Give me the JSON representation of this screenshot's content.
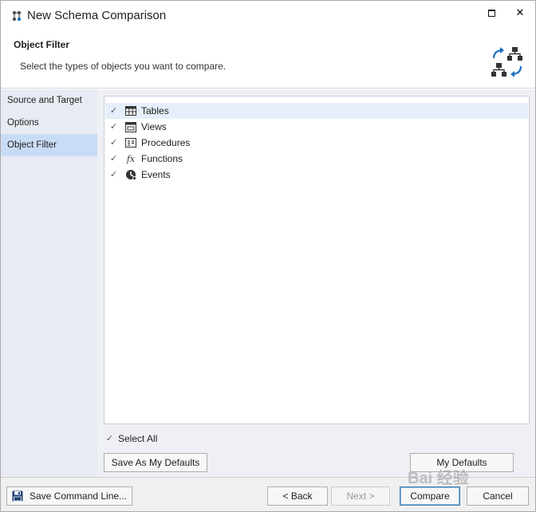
{
  "window": {
    "title": "New Schema Comparison",
    "maximize_icon": "maximize-icon",
    "close_glyph": "✕"
  },
  "header": {
    "title": "Object Filter",
    "description": "Select the types of objects you want to compare."
  },
  "sidebar": {
    "items": [
      {
        "label": "Source and Target",
        "active": false
      },
      {
        "label": "Options",
        "active": false
      },
      {
        "label": "Object Filter",
        "active": true
      }
    ]
  },
  "objects": {
    "items": [
      {
        "label": "Tables",
        "icon": "table-icon",
        "checked": true,
        "selected": true
      },
      {
        "label": "Views",
        "icon": "view-icon",
        "checked": true,
        "selected": false
      },
      {
        "label": "Procedures",
        "icon": "procedure-icon",
        "checked": true,
        "selected": false
      },
      {
        "label": "Functions",
        "icon": "function-icon",
        "checked": true,
        "selected": false
      },
      {
        "label": "Events",
        "icon": "event-icon",
        "checked": true,
        "selected": false
      }
    ],
    "check_glyph": "✓",
    "function_glyph": "fx"
  },
  "select_all": {
    "label": "Select All",
    "checked": true
  },
  "buttons": {
    "save_defaults": "Save As My Defaults",
    "my_defaults": "My Defaults",
    "save_command_line": "Save Command Line...",
    "back": "< Back",
    "next": "Next >",
    "compare": "Compare",
    "cancel": "Cancel"
  },
  "watermark": "Bai 经验",
  "colors": {
    "accent": "#1e6fc0",
    "selected_row": "#e5eefa",
    "sidebar_active": "#c9dcf5"
  }
}
